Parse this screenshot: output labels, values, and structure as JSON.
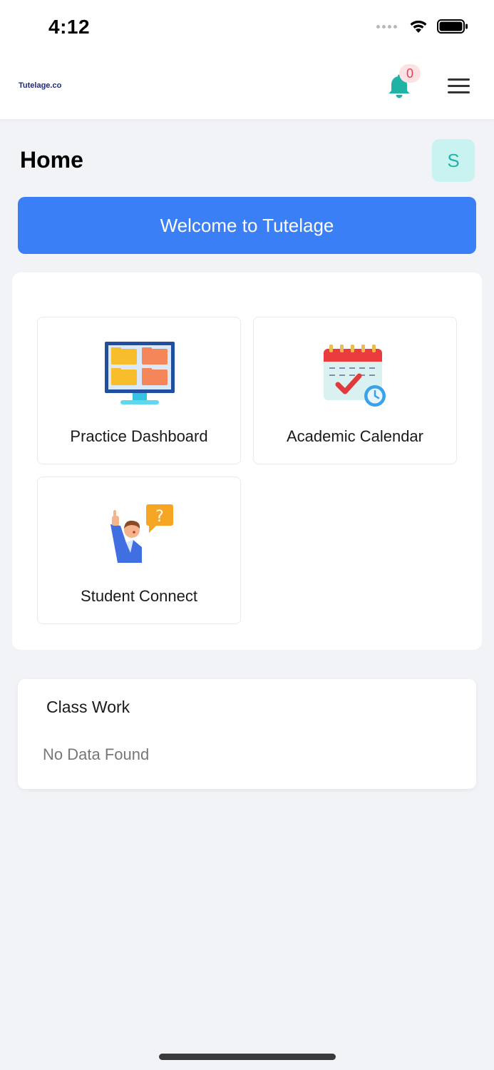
{
  "status_bar": {
    "time": "4:12"
  },
  "header": {
    "logo_text": "Tutelage.co",
    "notification_count": "0",
    "bell_color": "#1fb3a5"
  },
  "page": {
    "title": "Home",
    "avatar_initial": "S"
  },
  "banner": {
    "text": "Welcome to Tutelage",
    "color": "#3b7ff7"
  },
  "modules": [
    {
      "label": "Practice Dashboard",
      "icon": "monitor-folders-icon"
    },
    {
      "label": "Academic Calendar",
      "icon": "calendar-check-icon"
    },
    {
      "label": "Student Connect",
      "icon": "student-question-icon"
    }
  ],
  "classwork": {
    "title": "Class Work",
    "empty_text": "No Data Found"
  }
}
